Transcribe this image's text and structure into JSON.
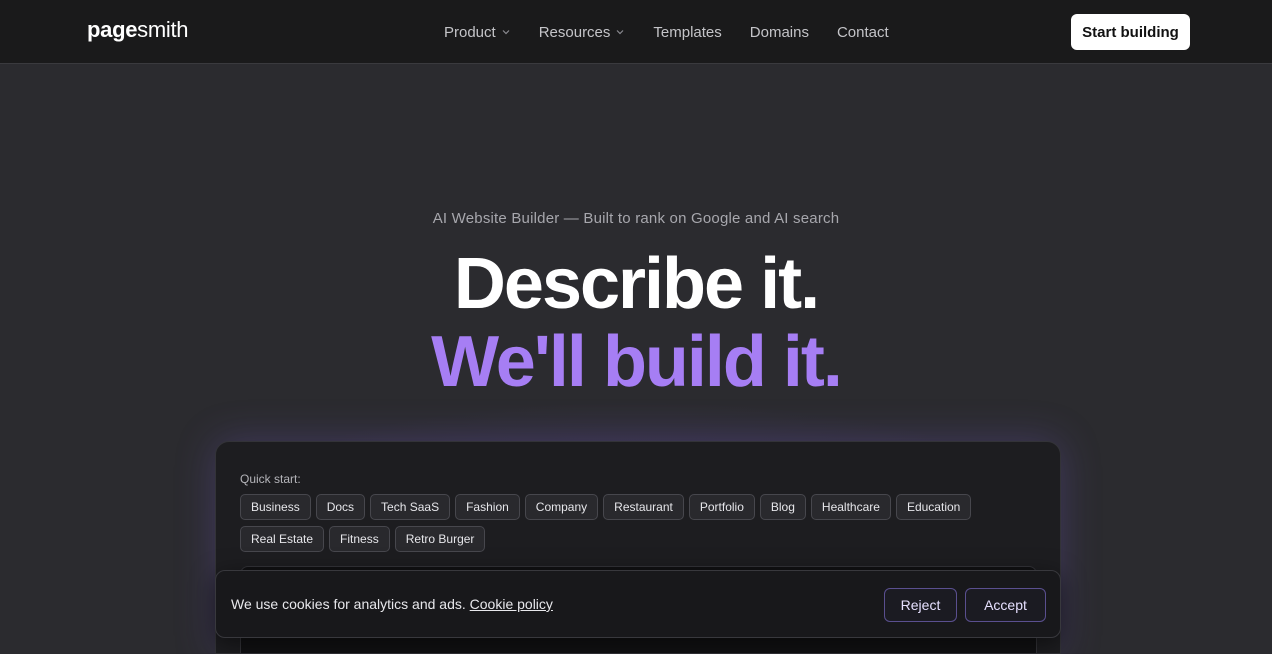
{
  "header": {
    "logo_strong": "page",
    "logo_light": "smith",
    "nav": [
      {
        "label": "Product",
        "dropdown": true
      },
      {
        "label": "Resources",
        "dropdown": true
      },
      {
        "label": "Templates",
        "dropdown": false
      },
      {
        "label": "Domains",
        "dropdown": false
      },
      {
        "label": "Contact",
        "dropdown": false
      }
    ],
    "cta": "Start building"
  },
  "hero": {
    "eyebrow": "AI Website Builder — Built to rank on Google and AI search",
    "line1": "Describe it.",
    "line2": "We'll build it."
  },
  "quick_start": {
    "label": "Quick start:",
    "chips": [
      "Business",
      "Docs",
      "Tech SaaS",
      "Fashion",
      "Company",
      "Restaurant",
      "Portfolio",
      "Blog",
      "Healthcare",
      "Education",
      "Real Estate",
      "Fitness",
      "Retro Burger"
    ]
  },
  "cookie": {
    "text": "We use cookies for analytics and ads.",
    "link": "Cookie policy",
    "reject": "Reject",
    "accept": "Accept"
  },
  "colors": {
    "accent": "#a67ef4",
    "background": "#2b2b2f",
    "topbar": "#1a1a1b"
  }
}
